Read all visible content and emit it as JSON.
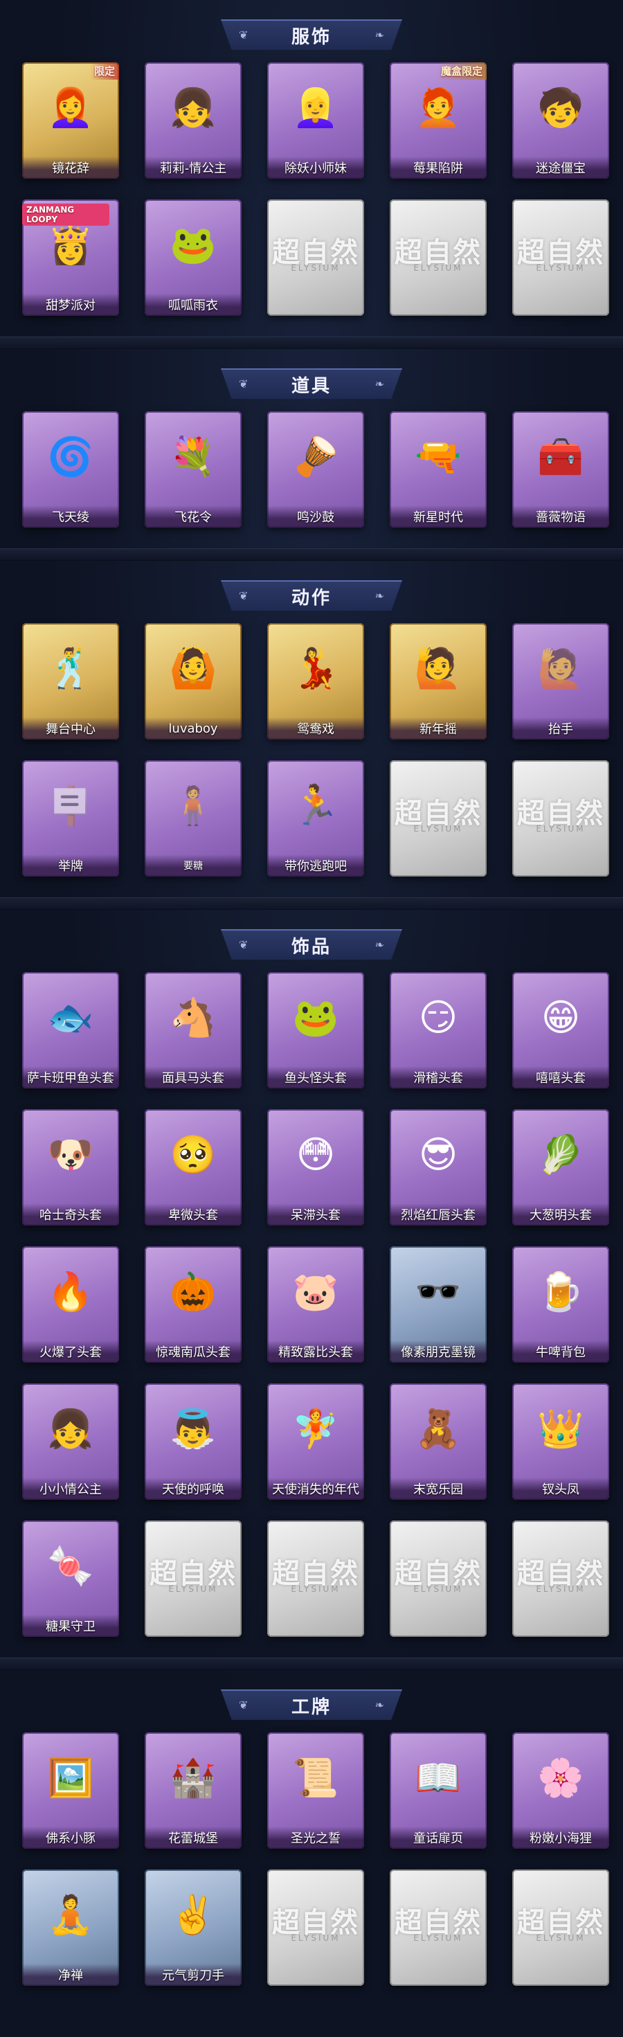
{
  "sections": [
    {
      "title": "服饰",
      "rows": [
        [
          {
            "label": "镜花辞",
            "tier": "gold",
            "icon": "hooded-girl-icon",
            "art": "👩‍🦰",
            "tag": "限定",
            "tag_style": "red"
          },
          {
            "label": "莉莉-情公主",
            "tier": "purple",
            "icon": "pink-hair-girl-icon",
            "art": "👧",
            "tag": "",
            "tag_style": "pink"
          },
          {
            "label": "除妖小师妹",
            "tier": "purple",
            "icon": "silver-hair-girl-icon",
            "art": "👱‍♀️",
            "tag": ""
          },
          {
            "label": "莓果陷阱",
            "tier": "purple",
            "icon": "berry-girl-icon",
            "art": "🧑‍🦰",
            "tag": "魔盒限定",
            "tag_style": "gold"
          },
          {
            "label": "迷途僵宝",
            "tier": "purple",
            "icon": "zombie-boy-icon",
            "art": "🧒",
            "tag": ""
          }
        ],
        [
          {
            "label": "甜梦派对",
            "tier": "purple",
            "icon": "loopy-girl-icon",
            "art": "👸",
            "tag": "ZANMANG LOOPY",
            "tag_style": "pink"
          },
          {
            "label": "呱呱雨衣",
            "tier": "purple",
            "icon": "frog-raincoat-girl-icon",
            "art": "🐸",
            "tag": ""
          },
          {
            "label": "",
            "tier": "empty"
          },
          {
            "label": "",
            "tier": "empty"
          },
          {
            "label": "",
            "tier": "empty"
          }
        ]
      ]
    },
    {
      "title": "道具",
      "rows": [
        [
          {
            "label": "飞天绫",
            "tier": "purple",
            "icon": "ribbon-icon",
            "art": "🌀"
          },
          {
            "label": "飞花令",
            "tier": "purple",
            "icon": "flower-ball-icon",
            "art": "💐"
          },
          {
            "label": "鸣沙鼓",
            "tier": "purple",
            "icon": "drum-icon",
            "art": "🪘"
          },
          {
            "label": "新星时代",
            "tier": "purple",
            "icon": "revolver-icon",
            "art": "🔫"
          },
          {
            "label": "蔷薇物语",
            "tier": "purple",
            "icon": "medkit-icon",
            "art": "🧰"
          }
        ]
      ]
    },
    {
      "title": "动作",
      "rows": [
        [
          {
            "label": "舞台中心",
            "tier": "gold",
            "icon": "dance-pose-icon",
            "art": "🕺",
            "silhouette": true
          },
          {
            "label": "luvaboy",
            "tier": "gold",
            "icon": "dance-pose-icon",
            "art": "🙆",
            "silhouette": true
          },
          {
            "label": "鸳鸯戏",
            "tier": "gold",
            "icon": "dance-pose-icon",
            "art": "💃",
            "silhouette": true
          },
          {
            "label": "新年摇",
            "tier": "gold",
            "icon": "dance-pose-icon",
            "art": "🙋",
            "silhouette": true
          },
          {
            "label": "抬手",
            "tier": "purple",
            "icon": "raise-hand-icon",
            "art": "🙋",
            "ghost": true
          }
        ],
        [
          {
            "label": "举牌",
            "tier": "purple",
            "icon": "sign-holder-icon",
            "art": "🪧",
            "ghost": true
          },
          {
            "label": "要糖",
            "tier": "purple",
            "icon": "candy-request-icon",
            "art": "🧍",
            "ghost": true,
            "small": true
          },
          {
            "label": "带你逃跑吧",
            "tier": "purple",
            "icon": "run-away-icon",
            "art": "🏃",
            "silhouette": true
          },
          {
            "label": "",
            "tier": "empty"
          },
          {
            "label": "",
            "tier": "empty"
          }
        ]
      ]
    },
    {
      "title": "饰品",
      "rows": [
        [
          {
            "label": "萨卡班甲鱼头套",
            "tier": "purple",
            "icon": "fish-head-icon",
            "art": "🐟"
          },
          {
            "label": "面具马头套",
            "tier": "purple",
            "icon": "horse-head-icon",
            "art": "🐴"
          },
          {
            "label": "鱼头怪头套",
            "tier": "purple",
            "icon": "green-fish-head-icon",
            "art": "🐸"
          },
          {
            "label": "滑稽头套",
            "tier": "purple",
            "icon": "smirk-face-icon",
            "art": "😏"
          },
          {
            "label": "嘻嘻头套",
            "tier": "purple",
            "icon": "grin-face-icon",
            "art": "😁"
          }
        ],
        [
          {
            "label": "哈士奇头套",
            "tier": "purple",
            "icon": "husky-head-icon",
            "art": "🐶"
          },
          {
            "label": "卑微头套",
            "tier": "purple",
            "icon": "humble-face-icon",
            "art": "🥺"
          },
          {
            "label": "呆滞头套",
            "tier": "purple",
            "icon": "dazed-face-icon",
            "art": "😳"
          },
          {
            "label": "烈焰红唇头套",
            "tier": "purple",
            "icon": "pikachu-head-icon",
            "art": "😎"
          },
          {
            "label": "大葱明头套",
            "tier": "purple",
            "icon": "scallion-head-icon",
            "art": "🥬"
          }
        ],
        [
          {
            "label": "火爆了头套",
            "tier": "purple",
            "icon": "fire-head-icon",
            "art": "🔥"
          },
          {
            "label": "惊魂南瓜头套",
            "tier": "purple",
            "icon": "pumpkin-head-icon",
            "art": "🎃"
          },
          {
            "label": "精致露比头套",
            "tier": "purple",
            "icon": "pink-beaver-head-icon",
            "art": "🐷"
          },
          {
            "label": "像素朋克墨镜",
            "tier": "blue",
            "icon": "pixel-sunglasses-icon",
            "art": "🕶️"
          },
          {
            "label": "牛啤背包",
            "tier": "purple",
            "icon": "beer-backpack-icon",
            "art": "🍺"
          }
        ],
        [
          {
            "label": "小小情公主",
            "tier": "purple",
            "icon": "little-princess-icon",
            "art": "👧"
          },
          {
            "label": "天使的呼唤",
            "tier": "purple",
            "icon": "angel-call-icon",
            "art": "👼"
          },
          {
            "label": "天使消失的年代",
            "tier": "purple",
            "icon": "angel-girl-icon",
            "art": "🧚"
          },
          {
            "label": "末宽乐园",
            "tier": "purple",
            "icon": "paradise-doll-icon",
            "art": "🧸"
          },
          {
            "label": "钗头凤",
            "tier": "purple",
            "icon": "phoenix-headdress-icon",
            "art": "👑"
          }
        ],
        [
          {
            "label": "糖果守卫",
            "tier": "purple",
            "icon": "candy-guard-icon",
            "art": "🍬"
          },
          {
            "label": "",
            "tier": "empty"
          },
          {
            "label": "",
            "tier": "empty"
          },
          {
            "label": "",
            "tier": "empty"
          },
          {
            "label": "",
            "tier": "empty"
          }
        ]
      ]
    },
    {
      "title": "工牌",
      "rows": [
        [
          {
            "label": "佛系小豚",
            "tier": "purple",
            "icon": "gold-frame-badge-icon",
            "art": "🖼️"
          },
          {
            "label": "花蕾城堡",
            "tier": "purple",
            "icon": "pink-castle-badge-icon",
            "art": "🏰"
          },
          {
            "label": "圣光之誓",
            "tier": "purple",
            "icon": "holy-light-badge-icon",
            "art": "📜"
          },
          {
            "label": "童话扉页",
            "tier": "purple",
            "icon": "fairy-page-badge-icon",
            "art": "📖"
          },
          {
            "label": "粉嫩小海狸",
            "tier": "purple",
            "icon": "pink-beaver-badge-icon",
            "art": "🌸"
          }
        ],
        [
          {
            "label": "净禅",
            "tier": "blue",
            "icon": "zen-badge-icon",
            "art": "🧘"
          },
          {
            "label": "元气剪刀手",
            "tier": "blue",
            "icon": "peace-sign-badge-icon",
            "art": "✌️"
          },
          {
            "label": "",
            "tier": "empty"
          },
          {
            "label": "",
            "tier": "empty"
          },
          {
            "label": "",
            "tier": "empty"
          }
        ]
      ]
    }
  ],
  "empty_watermark": "超自然",
  "empty_watermark_sub": "ELYSIUM"
}
